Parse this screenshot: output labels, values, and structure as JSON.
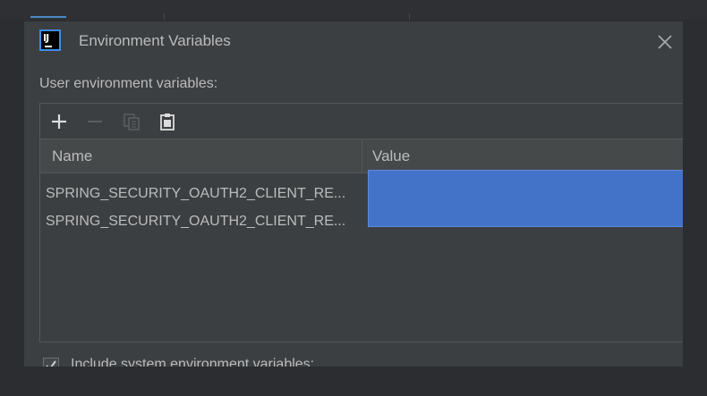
{
  "dialog": {
    "title": "Environment Variables",
    "section_label": "User environment variables:",
    "logo_text": "IJ"
  },
  "toolbar": {
    "add_icon": "plus-icon",
    "remove_icon": "minus-icon",
    "copy_icon": "copy-icon",
    "paste_icon": "clipboard-icon"
  },
  "table": {
    "columns": [
      "Name",
      "Value"
    ],
    "rows": [
      {
        "name": "SPRING_SECURITY_OAUTH2_CLIENT_RE...",
        "value": ""
      },
      {
        "name": "SPRING_SECURITY_OAUTH2_CLIENT_RE...",
        "value": ""
      }
    ]
  },
  "footer": {
    "include_system_label": "Include system environment variables:",
    "include_system_checked": true
  },
  "colors": {
    "accent": "#4a88c7",
    "selection": "#4273c8",
    "background": "#3c3f41"
  }
}
